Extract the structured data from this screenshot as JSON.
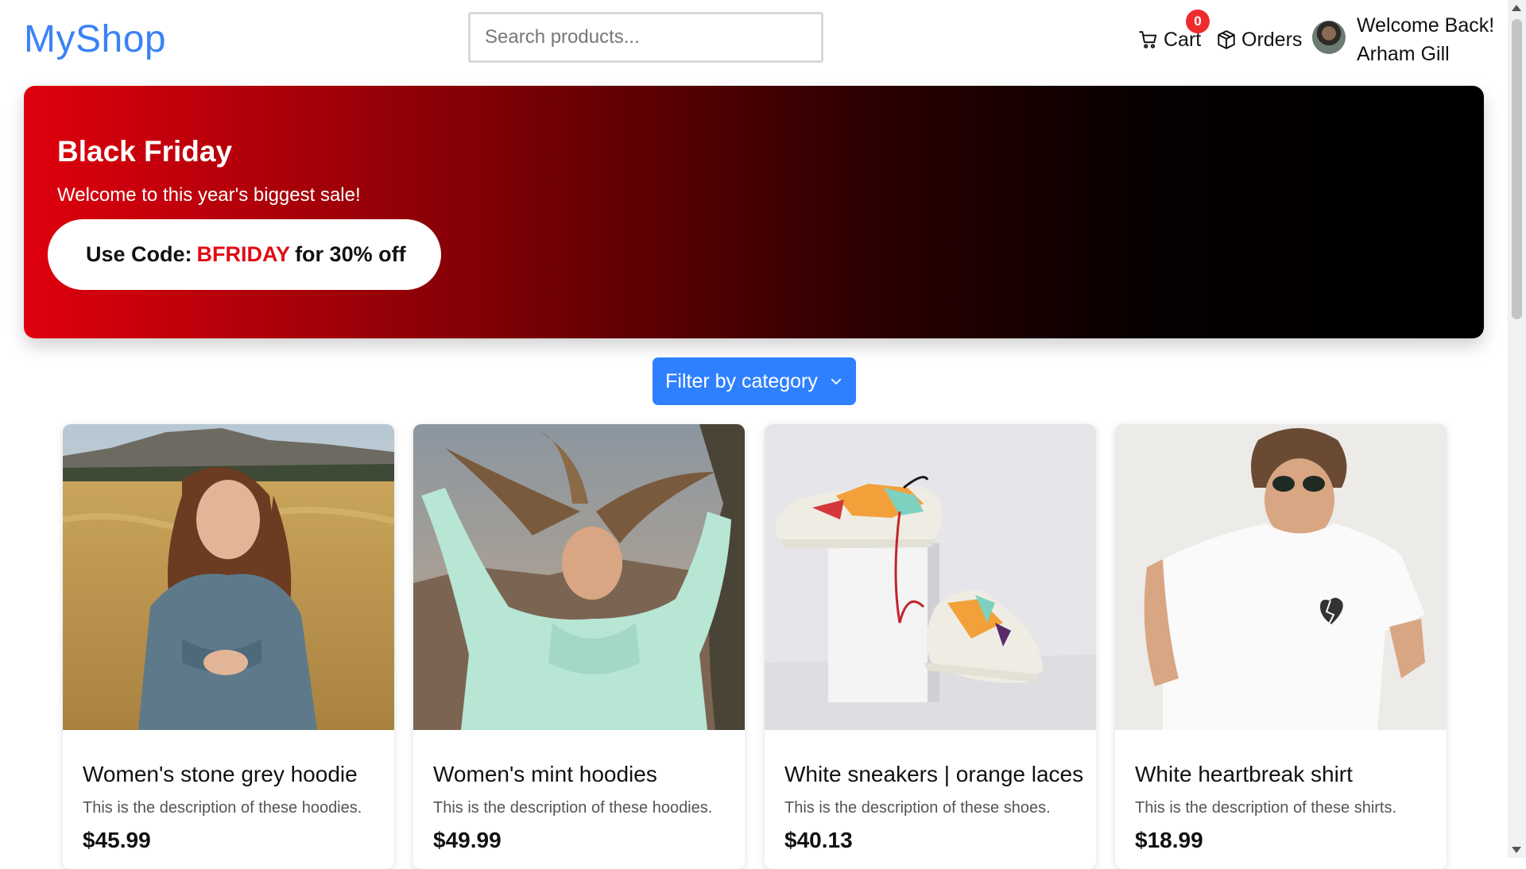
{
  "header": {
    "logo": "MyShop",
    "search_placeholder": "Search products...",
    "cart_label": "Cart",
    "cart_count": "0",
    "orders_label": "Orders",
    "welcome_line1": "Welcome Back!",
    "welcome_line2": "Arham Gill"
  },
  "banner": {
    "title": "Black Friday",
    "subtitle": "Welcome to this year's biggest sale!",
    "code_prefix": "Use Code:",
    "code": "BFRIDAY",
    "code_suffix": "for 30% off"
  },
  "filter": {
    "label": "Filter by category"
  },
  "products": [
    {
      "name": "Women's stone grey hoodie",
      "description": "This is the description of these hoodies.",
      "price": "$45.99"
    },
    {
      "name": "Women's mint hoodies",
      "description": "This is the description of these hoodies.",
      "price": "$49.99"
    },
    {
      "name": "White sneakers | orange laces",
      "description": "This is the description of these shoes.",
      "price": "$40.13"
    },
    {
      "name": "White heartbreak shirt",
      "description": "This is the description of these shirts.",
      "price": "$18.99"
    }
  ],
  "icons": {
    "cart": "cart-icon",
    "orders": "box-icon",
    "filter": "chevron-down-icon"
  },
  "colors": {
    "brand": "#3b82f6",
    "accent_button": "#2f80ff",
    "badge": "#ef2b2d",
    "promo_code": "#e00b13"
  }
}
